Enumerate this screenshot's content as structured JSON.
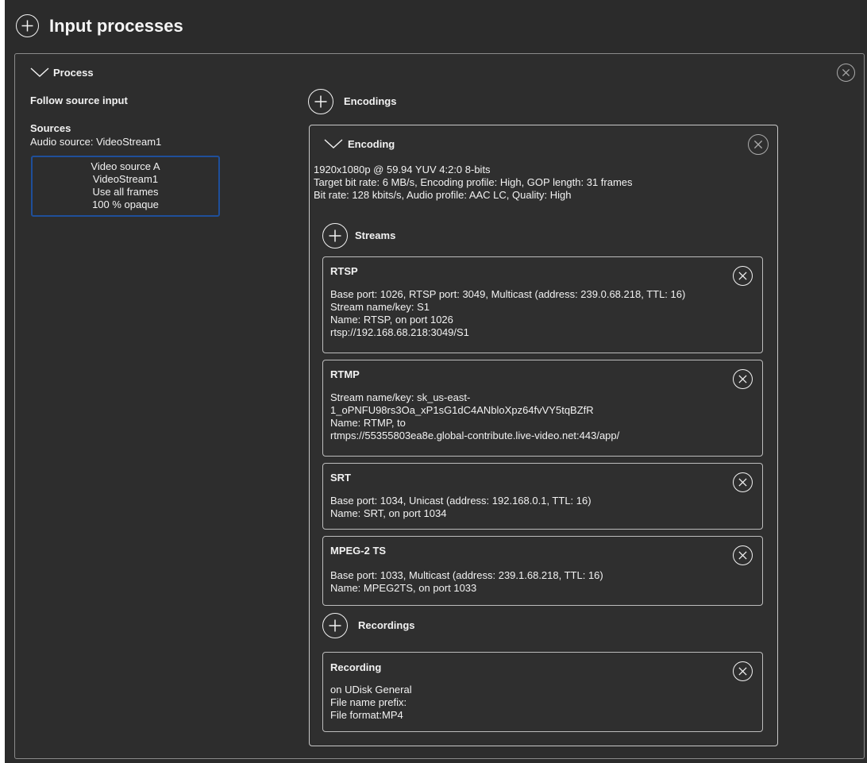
{
  "header": {
    "title": "Input processes"
  },
  "process": {
    "title": "Process",
    "follow_source": "Follow source input",
    "sources_heading": "Sources",
    "audio_source": "Audio source: VideoStream1",
    "video_source_lines": [
      "Video source A",
      "VideoStream1",
      "Use all frames",
      "100 % opaque"
    ]
  },
  "encodings": {
    "heading": "Encodings",
    "encoding": {
      "title": "Encoding",
      "lines": [
        "1920x1080p @ 59.94 YUV 4:2:0 8-bits",
        "Target bit rate: 6 MB/s, Encoding profile: High, GOP length: 31 frames",
        "Bit rate: 128 kbits/s, Audio profile: AAC LC, Quality: High"
      ],
      "streams_heading": "Streams",
      "streams": [
        {
          "title": "RTSP",
          "lines": [
            "Base port: 1026, RTSP port: 3049, Multicast (address: 239.0.68.218, TTL: 16)",
            "Stream name/key: S1",
            "Name: RTSP, on port 1026",
            "rtsp://192.168.68.218:3049/S1"
          ]
        },
        {
          "title": "RTMP",
          "lines": [
            "Stream name/key: sk_us-east-",
            "1_oPNFU98rs3Oa_xP1sG1dC4ANbloXpz64fvVY5tqBZfR",
            "Name: RTMP, to",
            "rtmps://55355803ea8e.global-contribute.live-video.net:443/app/"
          ]
        },
        {
          "title": "SRT",
          "lines": [
            "Base port: 1034, Unicast (address: 192.168.0.1, TTL: 16)",
            "Name: SRT, on port 1034"
          ]
        },
        {
          "title": "MPEG-2 TS",
          "lines": [
            "Base port: 1033, Multicast (address: 239.1.68.218, TTL: 16)",
            "Name: MPEG2TS, on port 1033"
          ]
        }
      ],
      "recordings_heading": "Recordings",
      "recording": {
        "title": "Recording",
        "lines": [
          "on UDisk General",
          "File name prefix:",
          "File format:MP4"
        ]
      }
    }
  }
}
